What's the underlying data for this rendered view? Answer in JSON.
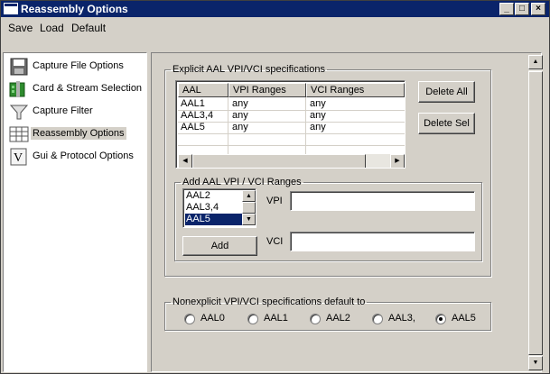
{
  "window": {
    "title": "Reassembly Options"
  },
  "menu": {
    "save": "Save",
    "load": "Load",
    "default": "Default"
  },
  "nav": {
    "items": [
      {
        "label": "Capture File Options",
        "icon": "floppy-disk-icon"
      },
      {
        "label": "Card & Stream Selection",
        "icon": "card-icon"
      },
      {
        "label": "Capture Filter",
        "icon": "funnel-icon"
      },
      {
        "label": "Reassembly Options",
        "icon": "grid-icon",
        "selected": true
      },
      {
        "label": "Gui & Protocol Options",
        "icon": "v-icon"
      }
    ]
  },
  "explicit": {
    "legend": "Explicit AAL VPI/VCI specifications",
    "columns": [
      "AAL",
      "VPI Ranges",
      "VCI Ranges"
    ],
    "rows": [
      [
        "AAL1",
        "any",
        "any"
      ],
      [
        "AAL3,4",
        "any",
        "any"
      ],
      [
        "AAL5",
        "any",
        "any"
      ]
    ],
    "delete_all": "Delete All",
    "delete_sel": "Delete Sel"
  },
  "add": {
    "legend": "Add AAL VPI / VCI Ranges",
    "options": [
      "AAL2",
      "AAL3,4",
      "AAL5"
    ],
    "selected": "AAL5",
    "vpi_label": "VPI",
    "vci_label": "VCI",
    "vpi_value": "",
    "vci_value": "",
    "add_button": "Add"
  },
  "nonexplicit": {
    "legend": "Nonexplicit VPI/VCI specifications default to",
    "options": [
      "AAL0",
      "AAL1",
      "AAL2",
      "AAL3,",
      "AAL5"
    ],
    "selected": "AAL5"
  }
}
